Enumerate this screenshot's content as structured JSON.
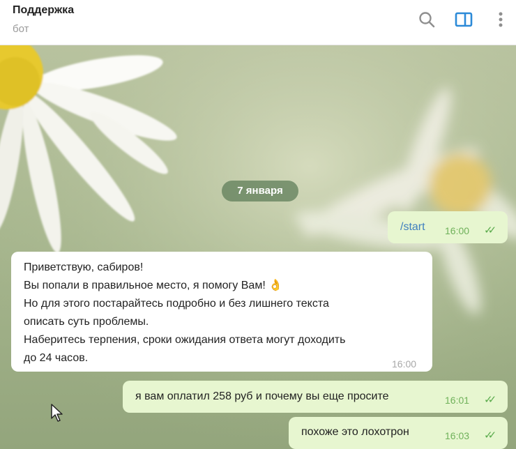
{
  "header": {
    "title": "Поддержка",
    "subtitle": "бот",
    "icons": [
      "search-icon",
      "sidebar-toggle-icon",
      "more-vertical-icon"
    ],
    "accent_color": "#2c8ad8"
  },
  "chat": {
    "date_separator": "7 января",
    "messages": [
      {
        "direction": "out",
        "text": "/start",
        "time": "16:00",
        "status": "read"
      },
      {
        "direction": "in",
        "lines": [
          "Приветствую, сабиров!",
          "Вы попали в правильное место, я помогу Вам! 👌",
          "Но для этого постарайтесь подробно и без лишнего текста",
          "описать суть проблемы.",
          "Наберитесь терпения, сроки ожидания ответа могут доходить",
          "до 24 часов."
        ],
        "time": "16:00"
      },
      {
        "direction": "out",
        "text": "я вам оплатил 258 руб и почему вы еще просите",
        "time": "16:01",
        "status": "read"
      },
      {
        "direction": "out",
        "text": "похоже это лохотрон",
        "time": "16:03",
        "status": "read"
      }
    ],
    "check_mark": "✓✓"
  },
  "colors": {
    "outgoing_bubble": "#e7f6d0",
    "incoming_bubble": "#ffffff",
    "check_color": "#5aab4c"
  }
}
